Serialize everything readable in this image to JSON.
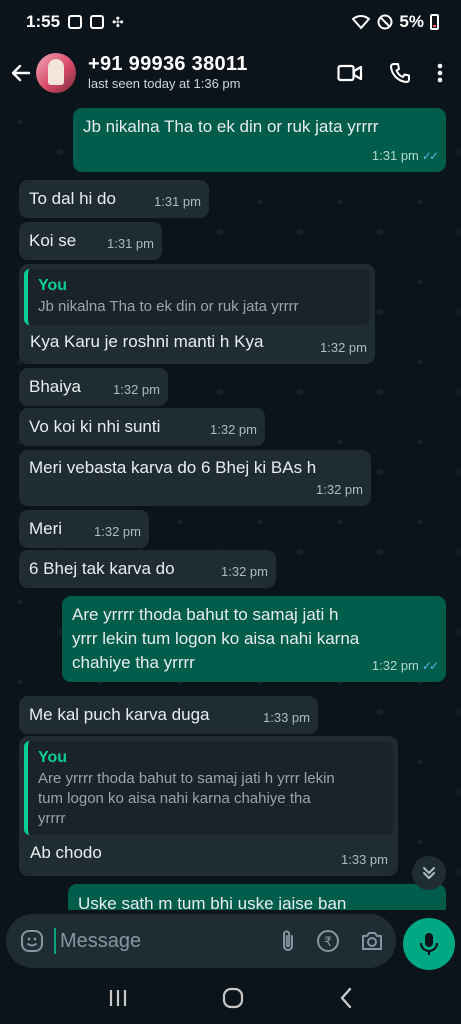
{
  "status": {
    "time": "1:55",
    "battery": "5%"
  },
  "header": {
    "contact_name": "+91 99936 38011",
    "last_seen": "last seen today at 1:36 pm"
  },
  "messages": [
    {
      "dir": "out",
      "text": "Jb nikalna Tha to ek din or ruk jata yrrrr",
      "time": "1:31 pm"
    },
    {
      "dir": "in",
      "text": "To dal hi do",
      "time": "1:31 pm"
    },
    {
      "dir": "in",
      "text": "Koi se",
      "time": "1:31 pm"
    },
    {
      "dir": "in",
      "quote_name": "You",
      "quote_text": "Jb nikalna Tha to ek din or ruk jata yrrrr",
      "text": "Kya Karu je roshni manti h Kya",
      "time": "1:32 pm"
    },
    {
      "dir": "in",
      "text": "Bhaiya",
      "time": "1:32 pm"
    },
    {
      "dir": "in",
      "text": "Vo koi ki nhi sunti",
      "time": "1:32 pm"
    },
    {
      "dir": "in",
      "text": "Meri vebasta karva do 6 Bhej ki BAs h",
      "time": "1:32 pm"
    },
    {
      "dir": "in",
      "text": "Meri",
      "time": "1:32 pm"
    },
    {
      "dir": "in",
      "text": "6 Bhej tak karva do",
      "time": "1:32 pm"
    },
    {
      "dir": "out",
      "text_lines": [
        "Are yrrrr thoda bahut to samaj jati h",
        "yrrr lekin tum logon ko aisa nahi karna",
        "chahiye tha yrrrr"
      ],
      "time": "1:32 pm"
    },
    {
      "dir": "in",
      "text": "Me kal puch karva duga",
      "time": "1:33 pm"
    },
    {
      "dir": "in",
      "quote_name": "You",
      "quote_lines": [
        "Are yrrrr thoda bahut to samaj jati h yrrr lekin",
        "tum logon ko aisa nahi karna chahiye tha",
        "yrrrr"
      ],
      "text": "Ab chodo",
      "time": "1:33 pm"
    },
    {
      "dir": "out",
      "text": "Uske sath m tum bhi uske jaise ban",
      "time": ""
    }
  ],
  "composer": {
    "placeholder": "Message"
  },
  "colors": {
    "accent": "#00a884",
    "outgoing": "#005c4b",
    "incoming": "#202c33",
    "read_tick": "#53bdeb"
  }
}
